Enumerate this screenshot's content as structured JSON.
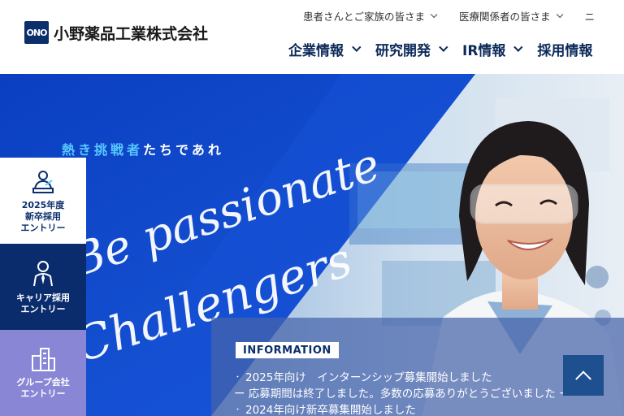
{
  "brand": {
    "logo_mark": "ONO",
    "name": "小野薬品工業株式会社"
  },
  "util_nav": {
    "items": [
      {
        "label": "患者さんとご家族の皆さま"
      },
      {
        "label": "医療関係者の皆さま"
      },
      {
        "label": "ニ"
      }
    ]
  },
  "main_nav": {
    "items": [
      {
        "label": "企業情報"
      },
      {
        "label": "研究開発"
      },
      {
        "label": "IR情報"
      },
      {
        "label": "採用情報"
      }
    ]
  },
  "hero": {
    "tagline_1": "熱き",
    "tagline_2": "挑戦者",
    "tagline_3": "たちであれ",
    "script_line_1": "Be passionate",
    "script_line_2": "Challengers"
  },
  "entries": {
    "new_grad": {
      "line1": "2025年度",
      "line2": "新卒採用",
      "line3": "エントリー"
    },
    "career": {
      "line1": "キャリア採用",
      "line2": "エントリー"
    },
    "group": {
      "line1": "グループ会社",
      "line2": "エントリー"
    }
  },
  "info": {
    "tag": "INFORMATION",
    "items": [
      {
        "line1": "2025年向け　インターンシップ募集開始しました",
        "line2": "ー 応募期間は終了しました。多数の応募ありがとうございました ー"
      },
      {
        "line1": "2024年向け新卒募集開始しました"
      }
    ]
  },
  "colors": {
    "brand_navy": "#0b2f6b",
    "hero_blue": "#0d46c9",
    "accent_cyan": "#59c8ff",
    "group_purple": "#8a86d6"
  }
}
